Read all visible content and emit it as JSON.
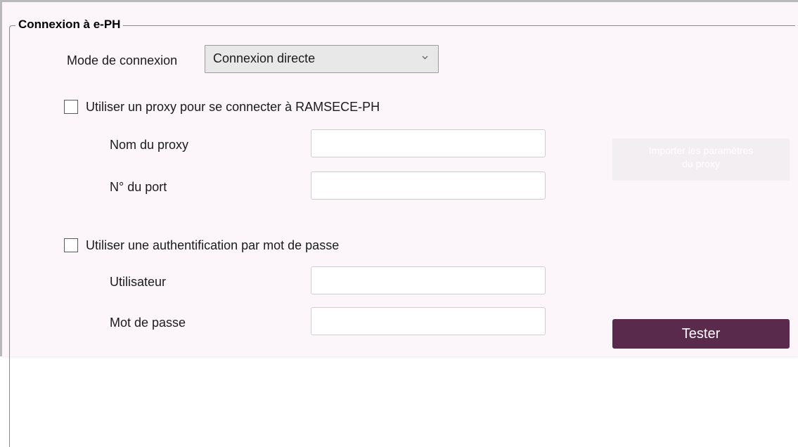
{
  "group": {
    "title": "Connexion à e-PH"
  },
  "connection_mode": {
    "label": "Mode de connexion",
    "selected": "Connexion directe"
  },
  "proxy": {
    "checkbox_label": "Utiliser un proxy pour se connecter à RAMSECE-PH",
    "checked": false,
    "name_label": "Nom du proxy",
    "name_value": "",
    "port_label": "N° du port",
    "port_value": "",
    "import_button_line1": "Importer les paramètres",
    "import_button_line2": "du proxy",
    "import_button_enabled": false
  },
  "auth": {
    "checkbox_label": "Utiliser une authentification par mot de passe",
    "checked": false,
    "user_label": "Utilisateur",
    "user_value": "",
    "password_label": "Mot de passe",
    "password_value": ""
  },
  "test_button": {
    "label": "Tester"
  },
  "colors": {
    "panel_background": "#fcf6fb",
    "accent_button": "#5a2a4c",
    "disabled_button": "#f3eef2"
  }
}
